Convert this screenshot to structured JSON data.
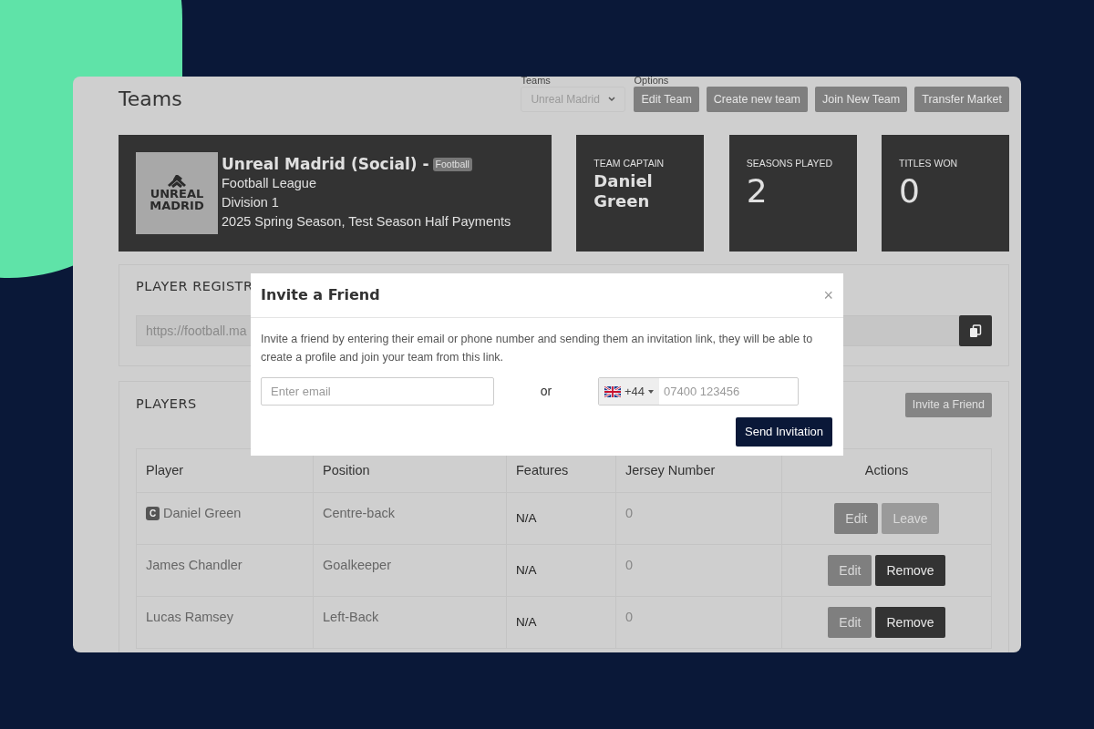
{
  "page": {
    "title": "Teams"
  },
  "team_select": {
    "label": "Teams",
    "value": "Unreal Madrid"
  },
  "options": {
    "label": "Options",
    "buttons": [
      "Edit Team",
      "Create new team",
      "Join New Team",
      "Transfer Market"
    ]
  },
  "team_card": {
    "logo_text": [
      "UNREAL",
      "MADRID"
    ],
    "name": "Unreal Madrid (Social) -",
    "tag": "Football",
    "lines": [
      "Football League",
      "Division 1",
      "2025 Spring Season, Test Season Half Payments"
    ]
  },
  "stats": [
    {
      "label": "TEAM CAPTAIN",
      "value": "Daniel Green",
      "kind": "name"
    },
    {
      "label": "SEASONS PLAYED",
      "value": "2",
      "kind": "number"
    },
    {
      "label": "TITLES WON",
      "value": "0",
      "kind": "number"
    }
  ],
  "registration": {
    "title": "PLAYER REGISTR",
    "link": "https://football.ma"
  },
  "players": {
    "title": "PLAYERS",
    "invite_button": "Invite a Friend",
    "table": {
      "columns": [
        "Player",
        "Position",
        "Features",
        "Jersey Number",
        "Actions"
      ],
      "rows": [
        {
          "badge": "C",
          "player": "Daniel Green",
          "position": "Centre-back",
          "features": "N/A",
          "jersey": "0",
          "actions": [
            {
              "label": "Edit",
              "kind": "edit"
            },
            {
              "label": "Leave",
              "kind": "leave"
            }
          ]
        },
        {
          "player": "James Chandler",
          "position": "Goalkeeper",
          "features": "N/A",
          "jersey": "0",
          "actions": [
            {
              "label": "Edit",
              "kind": "edit"
            },
            {
              "label": "Remove",
              "kind": "remove"
            }
          ]
        },
        {
          "player": "Lucas Ramsey",
          "position": "Left-Back",
          "features": "N/A",
          "jersey": "0",
          "actions": [
            {
              "label": "Edit",
              "kind": "edit"
            },
            {
              "label": "Remove",
              "kind": "remove"
            }
          ]
        }
      ]
    }
  },
  "modal": {
    "title": "Invite a Friend",
    "close": "×",
    "text": "Invite a friend by entering their email or phone number and sending them an invitation link, they will be able to create a profile and join your team from this link.",
    "email_placeholder": "Enter email",
    "or": "or",
    "dial_code": "+44",
    "phone_placeholder": "07400 123456",
    "submit": "Send Invitation"
  }
}
